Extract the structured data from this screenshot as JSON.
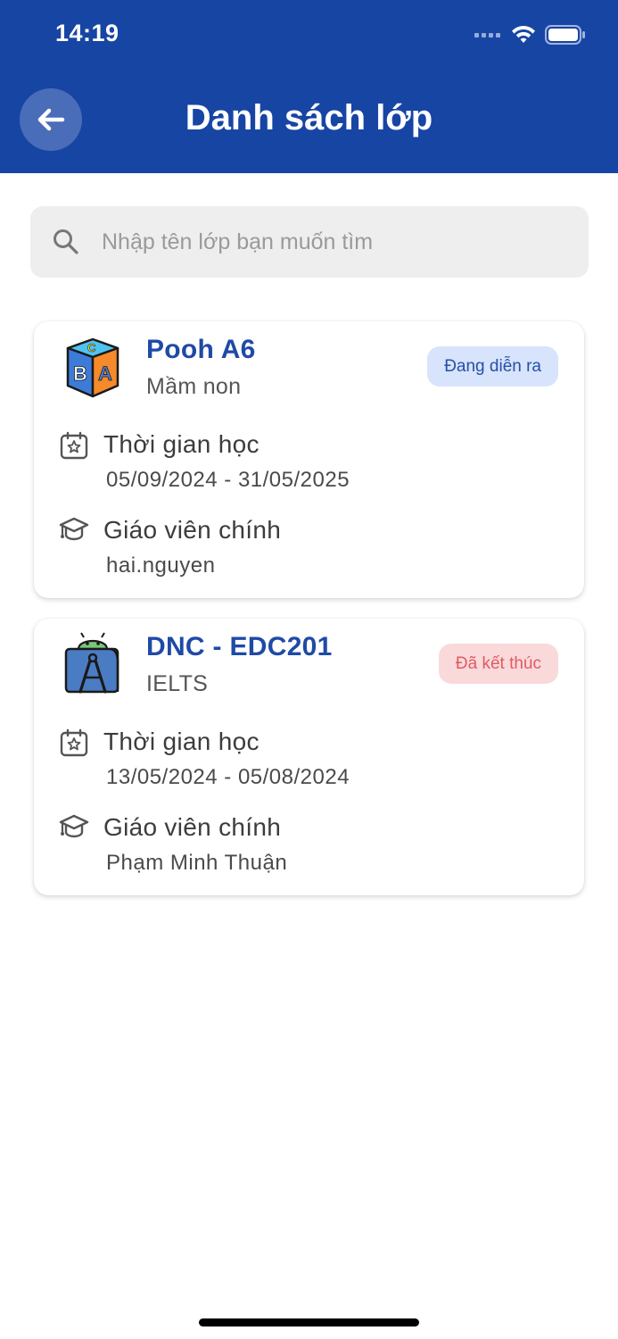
{
  "status_bar": {
    "time": "14:19"
  },
  "header": {
    "title": "Danh sách lớp"
  },
  "search": {
    "placeholder": "Nhập tên lớp bạn muốn tìm"
  },
  "classes": [
    {
      "name": "Pooh A6",
      "type": "Mầm non",
      "status": "Đang diễn ra",
      "time_label": "Thời gian học",
      "time_value": "05/09/2024 - 31/05/2025",
      "teacher_label": "Giáo viên chính",
      "teacher_value": "hai.nguyen",
      "icon": "abc-blocks-icon"
    },
    {
      "name": "DNC - EDC201",
      "type": "IELTS",
      "status": "Đã kết thúc",
      "time_label": "Thời gian học",
      "time_value": "13/05/2024 - 05/08/2024",
      "teacher_label": "Giáo viên chính",
      "teacher_value": "Phạm Minh Thuận",
      "icon": "android-compass-icon"
    }
  ],
  "colors": {
    "header_bg": "#1745a4",
    "class_name": "#1f4aa6",
    "active_badge_bg": "#d8e4fb",
    "active_badge_text": "#2550a8",
    "ended_badge_bg": "#fad9db",
    "ended_badge_text": "#e05b61"
  }
}
